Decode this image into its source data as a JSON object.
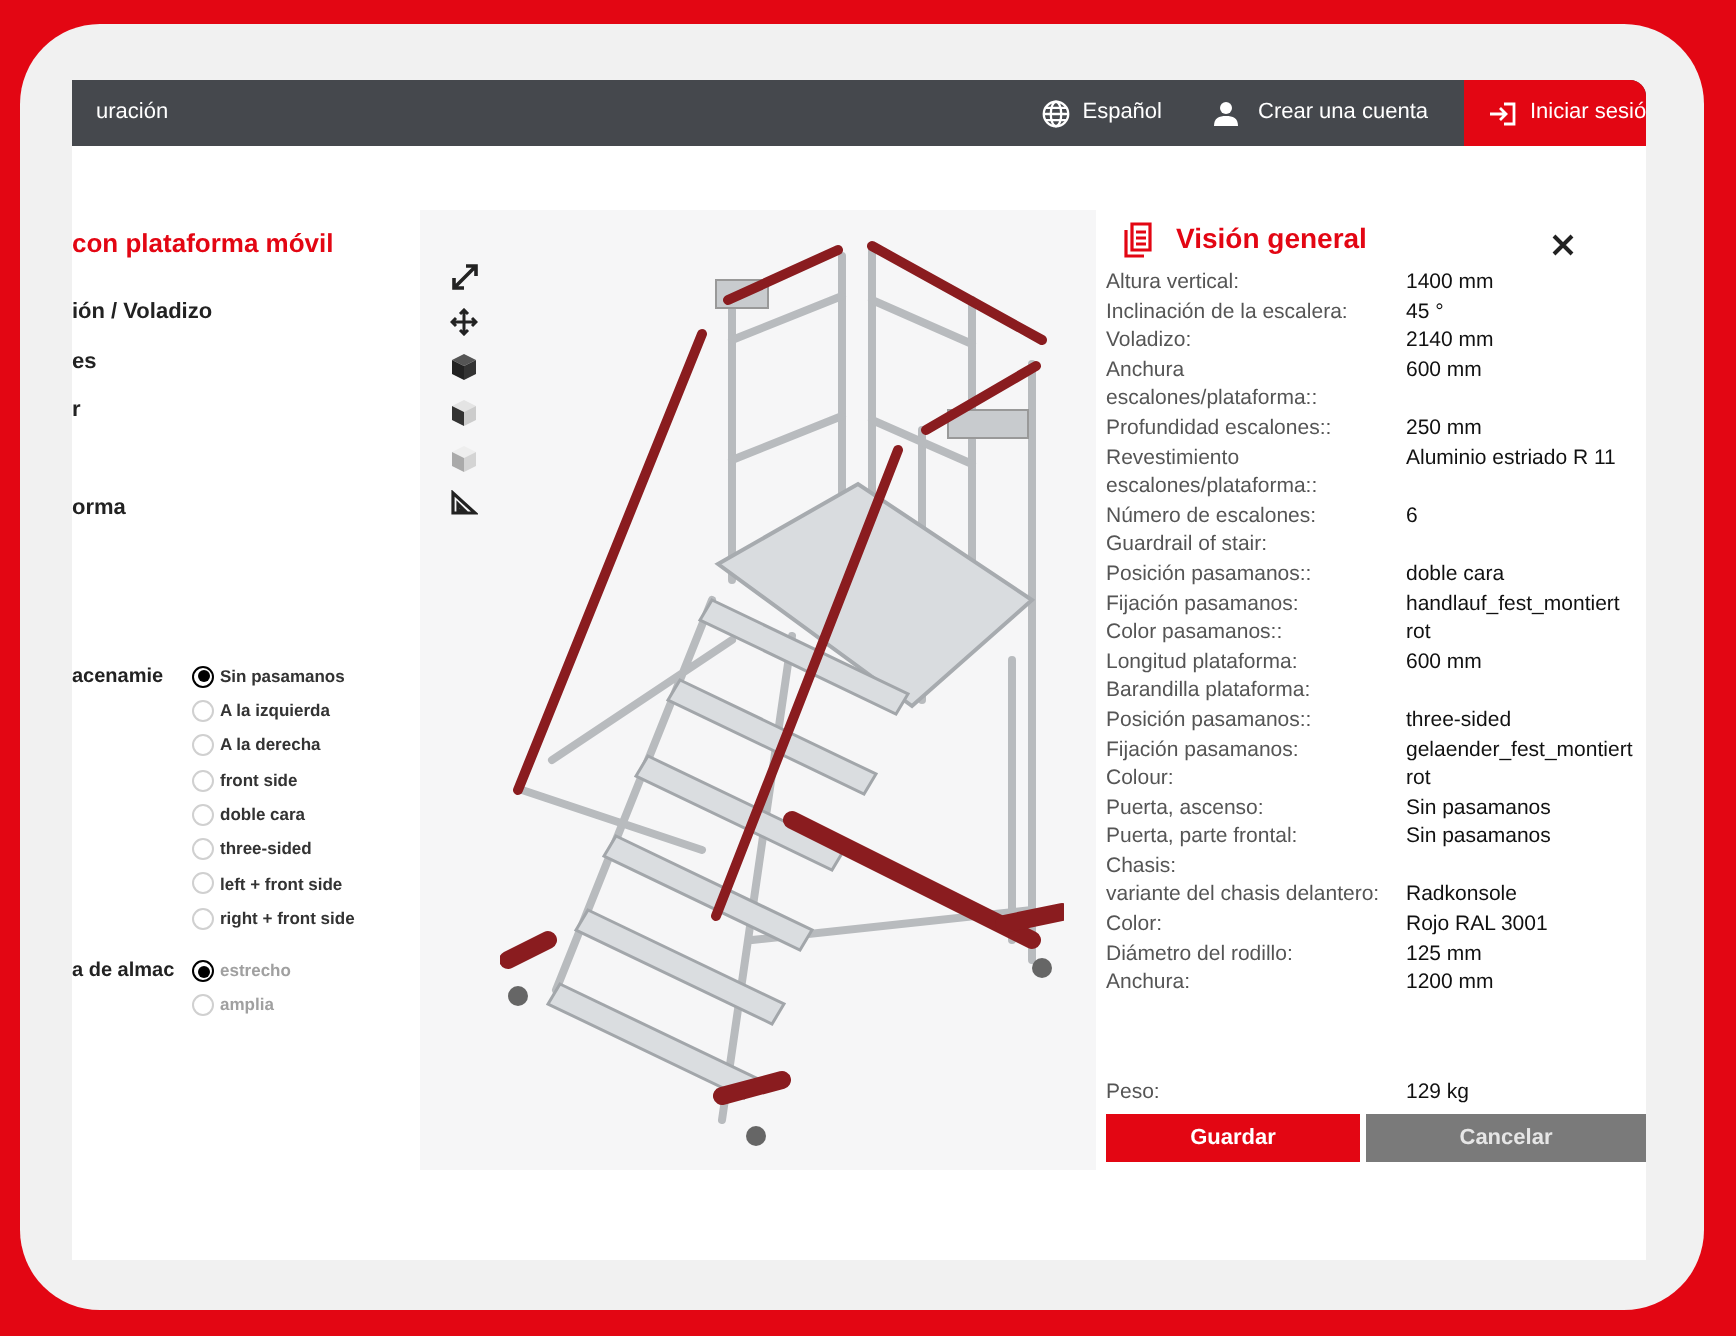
{
  "top_bar": {
    "breadcrumb": "uración",
    "language": "Español",
    "create_account": "Crear una cuenta",
    "login_button": "Iniciar sesió"
  },
  "configurator": {
    "title": "con plataforma móvil",
    "sections": [
      "ión / Voladizo",
      "es",
      "r",
      "orma"
    ],
    "option_groups": [
      {
        "label": "acenamie",
        "options": [
          {
            "label": "Sin pasamanos",
            "selected": true,
            "disabled": false
          },
          {
            "label": "A la izquierda",
            "selected": false,
            "disabled": false
          },
          {
            "label": "A la derecha",
            "selected": false,
            "disabled": false
          },
          {
            "label": "front side",
            "selected": false,
            "disabled": false
          },
          {
            "label": "doble cara",
            "selected": false,
            "disabled": false
          },
          {
            "label": "three-sided",
            "selected": false,
            "disabled": false
          },
          {
            "label": "left + front side",
            "selected": false,
            "disabled": false
          },
          {
            "label": "right + front side",
            "selected": false,
            "disabled": false
          }
        ]
      },
      {
        "label": "a de almac",
        "options": [
          {
            "label": "estrecho",
            "selected": true,
            "disabled": true
          },
          {
            "label": "amplia",
            "selected": false,
            "disabled": true
          }
        ]
      }
    ]
  },
  "overview": {
    "title": "Visión general",
    "rows": [
      {
        "label": "Altura vertical:",
        "value": "1400 mm"
      },
      {
        "label": "Inclinación de la escalera:",
        "value": "45 °"
      },
      {
        "label": "Voladizo:",
        "value": "2140 mm"
      },
      {
        "label": "Anchura\nescalones/plataforma::",
        "value": "600 mm"
      },
      {
        "label": "Profundidad escalones::",
        "value": "250 mm"
      },
      {
        "label": "Revestimiento\nescalones/plataforma::",
        "value": "Aluminio estriado R 11"
      },
      {
        "label": "Número de escalones:",
        "value": "6"
      },
      {
        "label": "Guardrail of stair:"
      },
      {
        "label": "Posición pasamanos::",
        "value": "doble cara"
      },
      {
        "label": "Fijación pasamanos:",
        "value": "handlauf_fest_montiert"
      },
      {
        "label": "Color pasamanos::",
        "value": "rot"
      },
      {
        "label": "Longitud plataforma:",
        "value": "600 mm"
      },
      {
        "label": "Barandilla plataforma:"
      },
      {
        "label": "Posición pasamanos::",
        "value": "three-sided"
      },
      {
        "label": "Fijación pasamanos:",
        "value": "gelaender_fest_montiert"
      },
      {
        "label": "Colour:",
        "value": "rot"
      },
      {
        "label": "Puerta,  ascenso:",
        "value": "Sin pasamanos"
      },
      {
        "label": "Puerta, parte frontal:",
        "value": "Sin pasamanos"
      },
      {
        "label": "Chasis:"
      },
      {
        "label": "variante del chasis delantero:",
        "value": "Radkonsole"
      },
      {
        "label": "Color:",
        "value": "Rojo RAL 3001"
      },
      {
        "label": "Diámetro del rodillo:",
        "value": "125 mm"
      },
      {
        "label": "Anchura:",
        "value": "1200 mm"
      }
    ],
    "weight": {
      "label": "Peso:",
      "value": "129 kg"
    },
    "buttons": [
      {
        "label": "Guardar",
        "kind": "primary"
      },
      {
        "label": "Cancelar",
        "kind": "secondary"
      }
    ]
  }
}
